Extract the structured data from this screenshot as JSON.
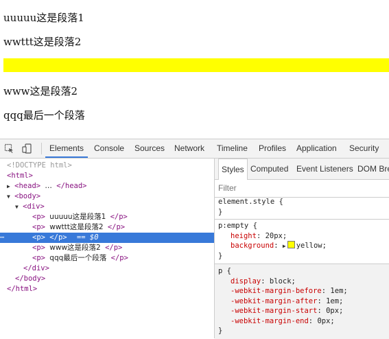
{
  "preview": {
    "paragraphs": [
      {
        "text": "uuuuu这是段落1"
      },
      {
        "text": "wwttt这是段落2"
      },
      {
        "text": "www这是段落2"
      },
      {
        "text": "qqq最后一个段落"
      }
    ],
    "empty_paragraph_color": "#ffff00"
  },
  "toolbar": {
    "tabs": [
      "Elements",
      "Console",
      "Sources",
      "Network",
      "Timeline",
      "Profiles",
      "Application",
      "Security"
    ],
    "active_tab": "Elements",
    "accent_color": "#3879d9"
  },
  "dom_tree": {
    "doctype": "<!DOCTYPE html>",
    "html_open": "<html>",
    "head": "<head>",
    "head_ellipsis": "…",
    "head_close": "</head>",
    "body_open": "<body>",
    "div_open": "<div>",
    "p_open": "<p>",
    "p_close": "</p>",
    "p1_text": "uuuuu这是段落1",
    "p2_text": "wwttt这是段落2",
    "p4_text": "www这是段落2",
    "p5_text": "qqq最后一个段落",
    "selected_marker": "== $0",
    "row_marker": "⋯",
    "div_close": "</div>",
    "body_close": "</body>",
    "html_close": "</html>"
  },
  "styles_pane": {
    "subtabs": [
      "Styles",
      "Computed",
      "Event Listeners",
      "DOM Bre"
    ],
    "active_subtab": "Styles",
    "filter_placeholder": "Filter",
    "rules": {
      "element_style": {
        "selector": "element.style {",
        "close": "}"
      },
      "p_empty": {
        "selector": "p:empty {",
        "height_name": "height",
        "height_value": "20px;",
        "background_name": "background",
        "background_value": "yellow;",
        "close": "}"
      },
      "p_ua": {
        "selector": "p {",
        "props": [
          {
            "name": "display",
            "value": "block;"
          },
          {
            "name": "-webkit-margin-before",
            "value": "1em;"
          },
          {
            "name": "-webkit-margin-after",
            "value": "1em;"
          },
          {
            "name": "-webkit-margin-start",
            "value": "0px;"
          },
          {
            "name": "-webkit-margin-end",
            "value": "0px;"
          }
        ],
        "close": "}"
      }
    }
  }
}
